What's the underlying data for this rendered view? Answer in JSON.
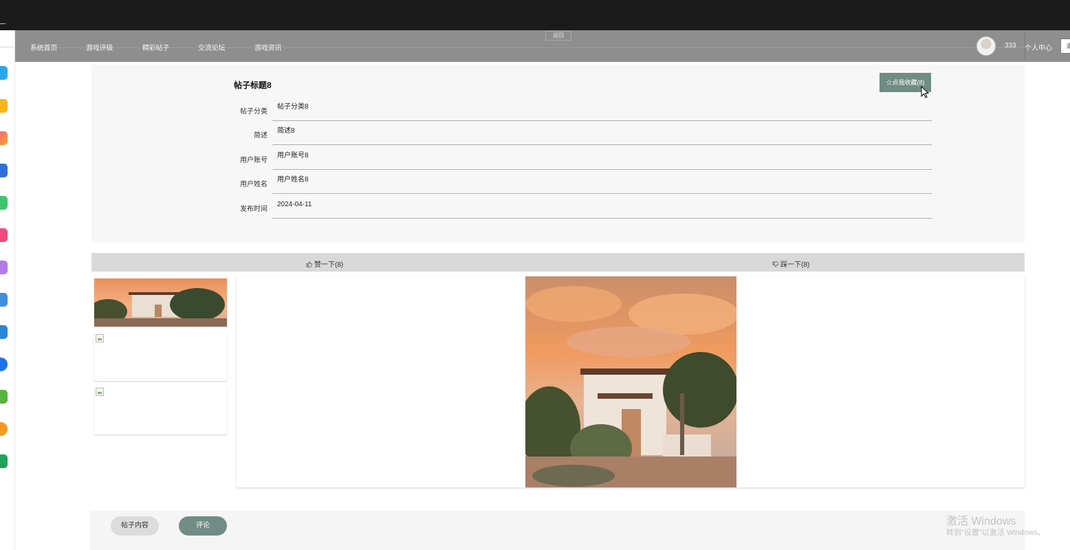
{
  "nav": {
    "items": [
      "系统首页",
      "游戏评级",
      "精彩帖子",
      "交流论坛",
      "游戏资讯"
    ],
    "back_label": "返回",
    "username": "333",
    "personal_center": "个人中心",
    "logout_label": "退"
  },
  "post": {
    "title": "帖子标题8",
    "favorite_label": "☆点我收藏(8)",
    "fields": [
      {
        "label": "帖子分类",
        "value": "帖子分类8"
      },
      {
        "label": "简述",
        "value": "简述8"
      },
      {
        "label": "用户账号",
        "value": "用户账号8"
      },
      {
        "label": "用户姓名",
        "value": "用户姓名8"
      },
      {
        "label": "发布时间",
        "value": "2024-04-11"
      }
    ]
  },
  "votes": {
    "like_label": "赞一下(8)",
    "dislike_label": "踩一下(8)"
  },
  "tabs": {
    "content_label": "帖子内容",
    "comment_label": "评论"
  },
  "watermark": {
    "line1": "激活 Windows",
    "line2": "转到\"设置\"以激活 Windows。"
  },
  "colors": {
    "accent": "#708c84",
    "navbar": "#8e8e8e",
    "topbar": "#1b1b1b"
  }
}
